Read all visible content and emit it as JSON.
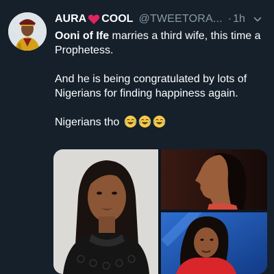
{
  "tweet": {
    "author": {
      "name_before": "AURA",
      "name_after": "COOL",
      "handle": "@TWEETORA...",
      "separator": "·",
      "time": "1h"
    },
    "paragraphs": {
      "p1_bold": "Ooni of Ife",
      "p1_rest": " marries a third wife, this time a Prophetess.",
      "p2": "And he is being congratulated by lots of Nigerians for finding happiness again.",
      "p3": "Nigerians tho"
    },
    "icons": {
      "heart": "red-heart-icon",
      "laugh": "face-with-tears-of-joy-icon",
      "menu": "chevron-down-icon"
    },
    "colors": {
      "background": "#15202b",
      "secondary_text": "#8899a6",
      "heart": "#e0245e"
    }
  }
}
